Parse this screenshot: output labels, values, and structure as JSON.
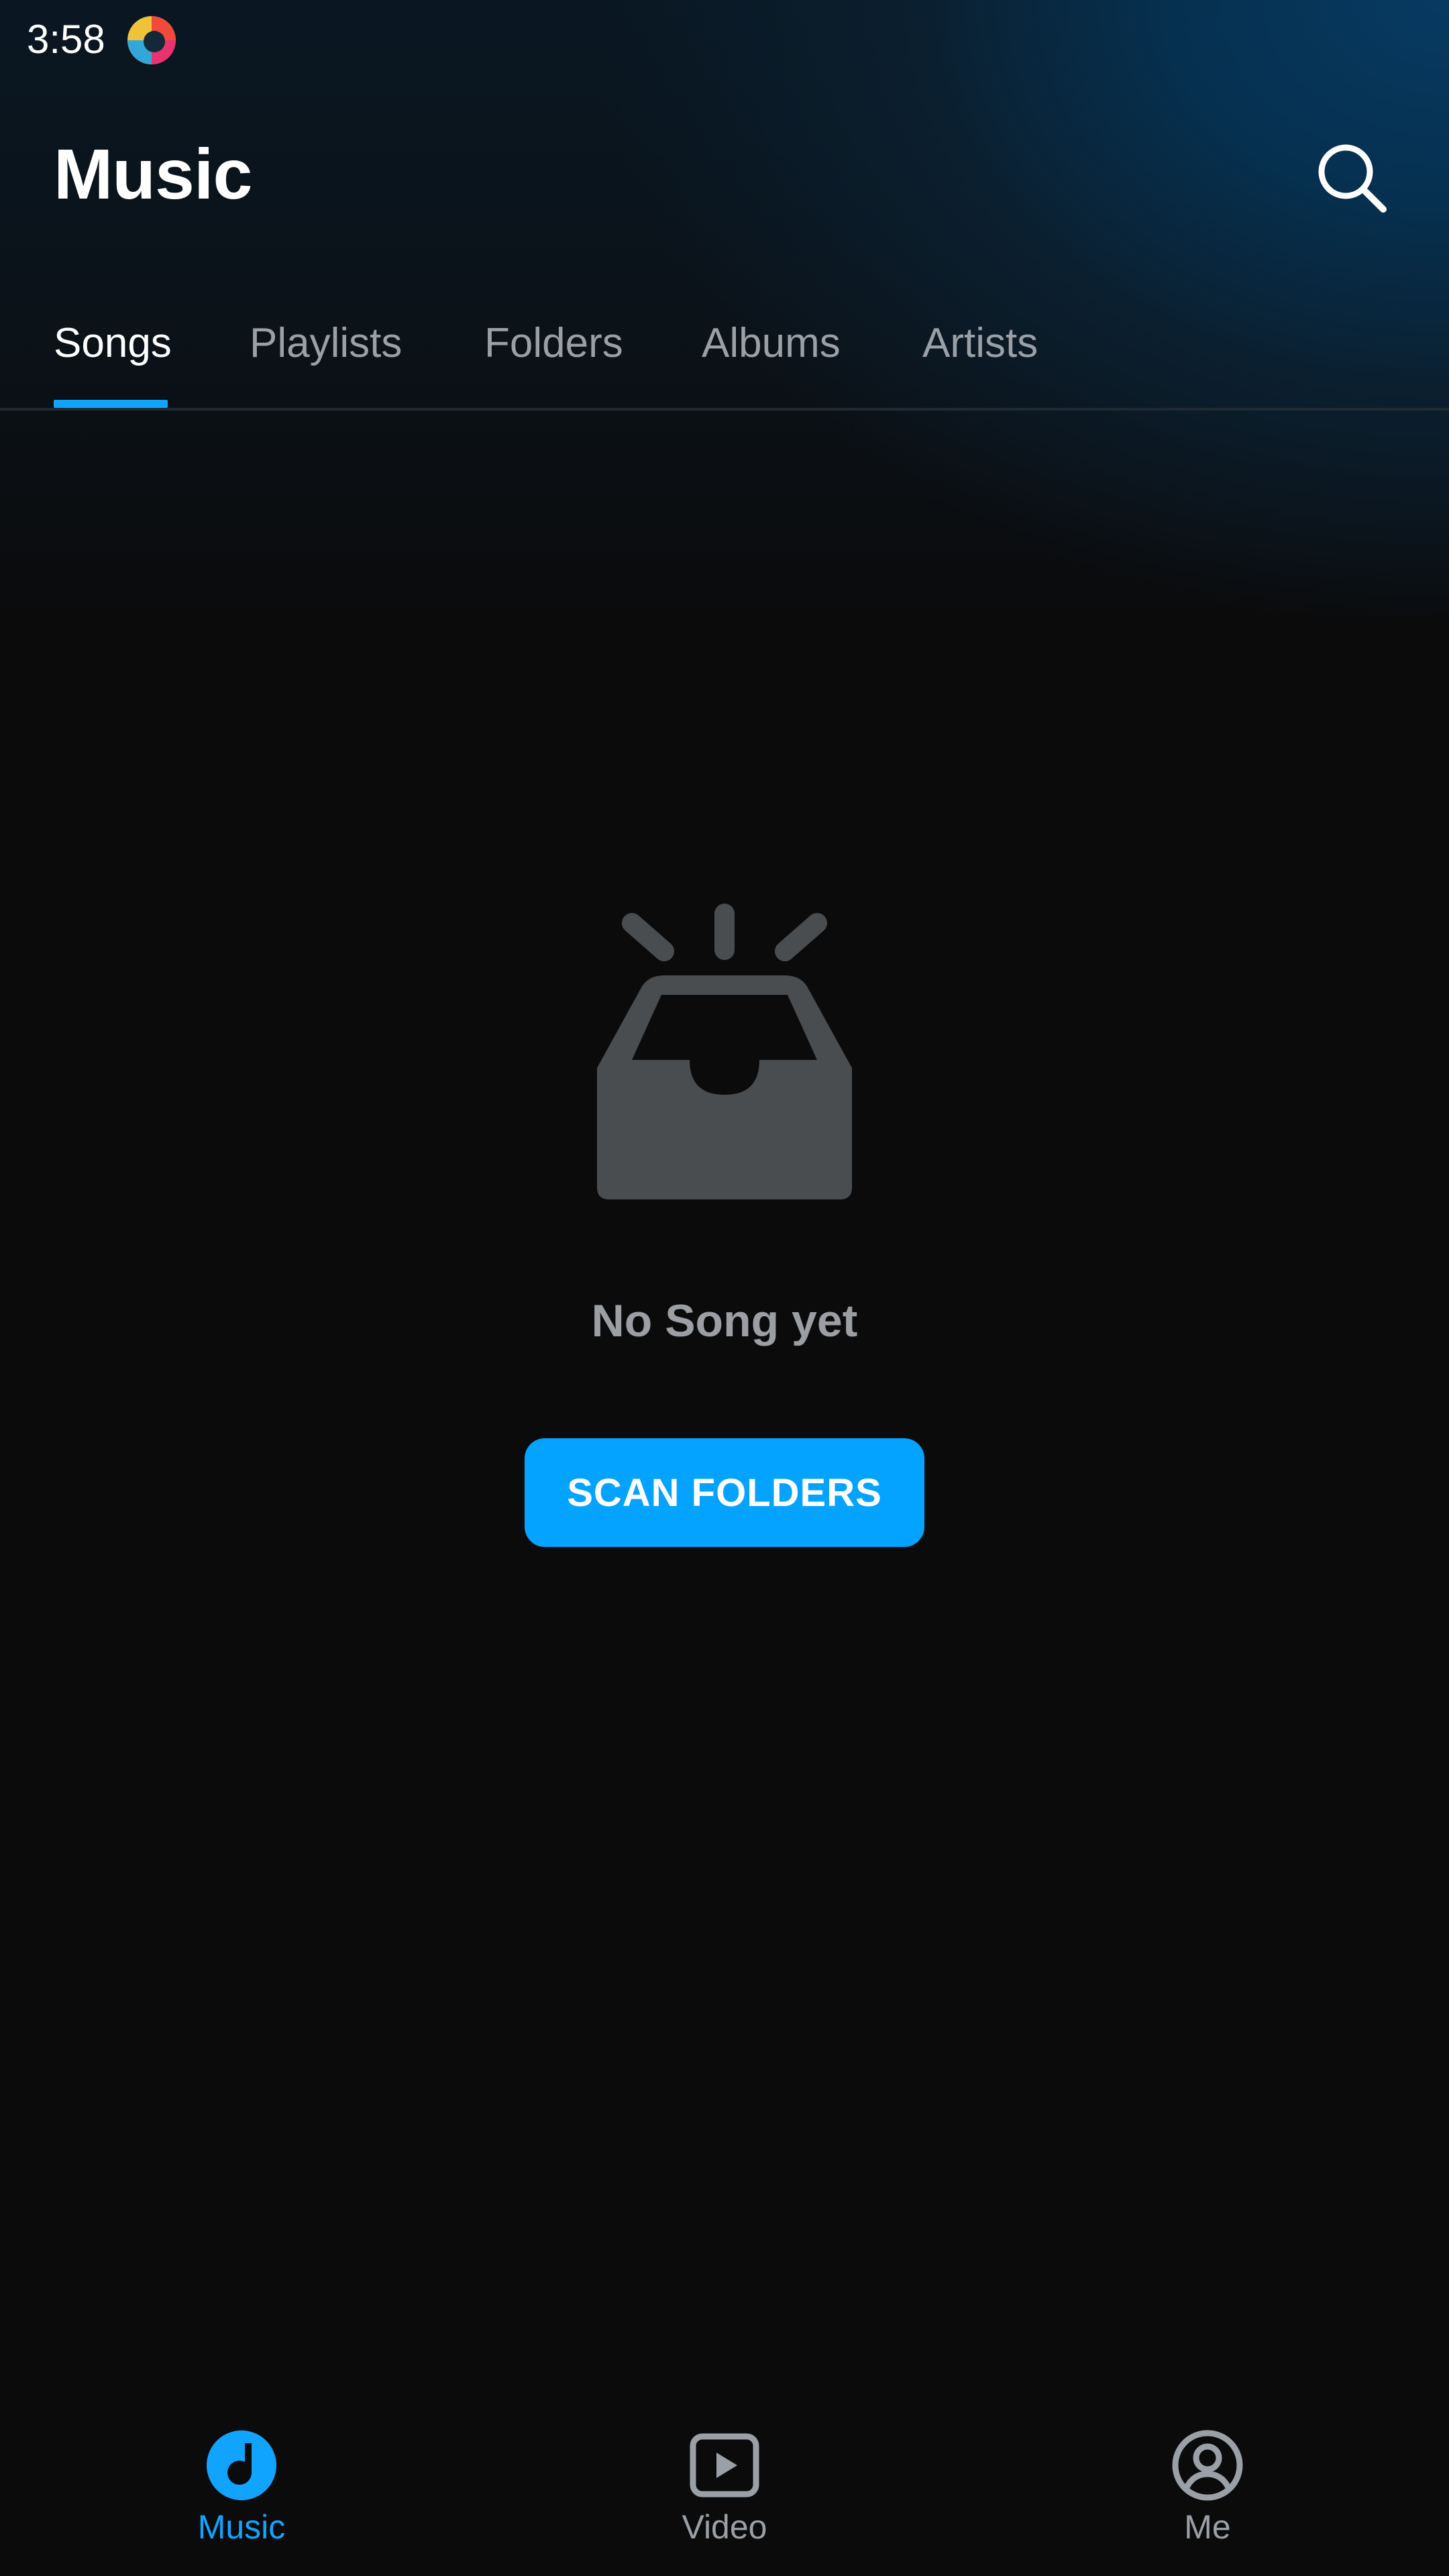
{
  "status_bar": {
    "time": "3:58",
    "app_icon": "colorful-app-icon"
  },
  "header": {
    "title": "Music",
    "search_icon": "search-icon"
  },
  "tabs": [
    {
      "label": "Songs",
      "active": true
    },
    {
      "label": "Playlists",
      "active": false
    },
    {
      "label": "Folders",
      "active": false
    },
    {
      "label": "Albums",
      "active": false
    },
    {
      "label": "Artists",
      "active": false
    }
  ],
  "empty_state": {
    "icon": "empty-inbox-icon",
    "message": "No Song yet",
    "button_label": "SCAN FOLDERS"
  },
  "bottom_nav": [
    {
      "label": "Music",
      "icon": "music-note-icon",
      "active": true
    },
    {
      "label": "Video",
      "icon": "video-play-icon",
      "active": false
    },
    {
      "label": "Me",
      "icon": "profile-icon",
      "active": false
    }
  ],
  "colors": {
    "accent": "#04a3ff",
    "background": "#0b0b0c",
    "muted_text": "#9aa0a6",
    "empty_icon": "#4a4d50"
  }
}
